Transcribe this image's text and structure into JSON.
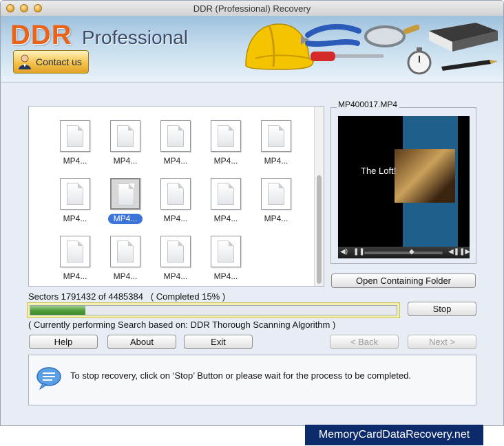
{
  "window": {
    "title": "DDR (Professional) Recovery"
  },
  "banner": {
    "brand_main": "DDR",
    "brand_sub": "Professional",
    "contact_label": "Contact us"
  },
  "files": [
    {
      "label": "MP4...",
      "selected": false
    },
    {
      "label": "MP4...",
      "selected": false
    },
    {
      "label": "MP4...",
      "selected": false
    },
    {
      "label": "MP4...",
      "selected": false
    },
    {
      "label": "MP4...",
      "selected": false
    },
    {
      "label": "MP4...",
      "selected": false
    },
    {
      "label": "MP4...",
      "selected": true
    },
    {
      "label": "MP4...",
      "selected": false
    },
    {
      "label": "MP4...",
      "selected": false
    },
    {
      "label": "MP4...",
      "selected": false
    },
    {
      "label": "MP4...",
      "selected": false
    },
    {
      "label": "MP4...",
      "selected": false
    },
    {
      "label": "MP4...",
      "selected": false
    },
    {
      "label": "MP4...",
      "selected": false
    }
  ],
  "preview": {
    "filename": "MP400017.MP4",
    "video_text": "The Loft!",
    "open_folder_label": "Open Containing Folder"
  },
  "scan": {
    "sectors_text": "Sectors 1791432 of 4485384   ( Completed 15% )",
    "progress_percent": 15,
    "stop_label": "Stop",
    "algorithm_text": "( Currently performing Search based on: DDR Thorough Scanning Algorithm )"
  },
  "buttons": {
    "help": "Help",
    "about": "About",
    "exit": "Exit",
    "back": "< Back",
    "next": "Next >"
  },
  "message": {
    "text": "To stop recovery, click on ‘Stop’ Button or please wait for the process to be completed."
  },
  "watermark": "MemoryCardDataRecovery.net",
  "colors": {
    "progress_green": "#4f9a3a",
    "brand_orange": "#e8641c",
    "selection_blue": "#3b73d9"
  }
}
